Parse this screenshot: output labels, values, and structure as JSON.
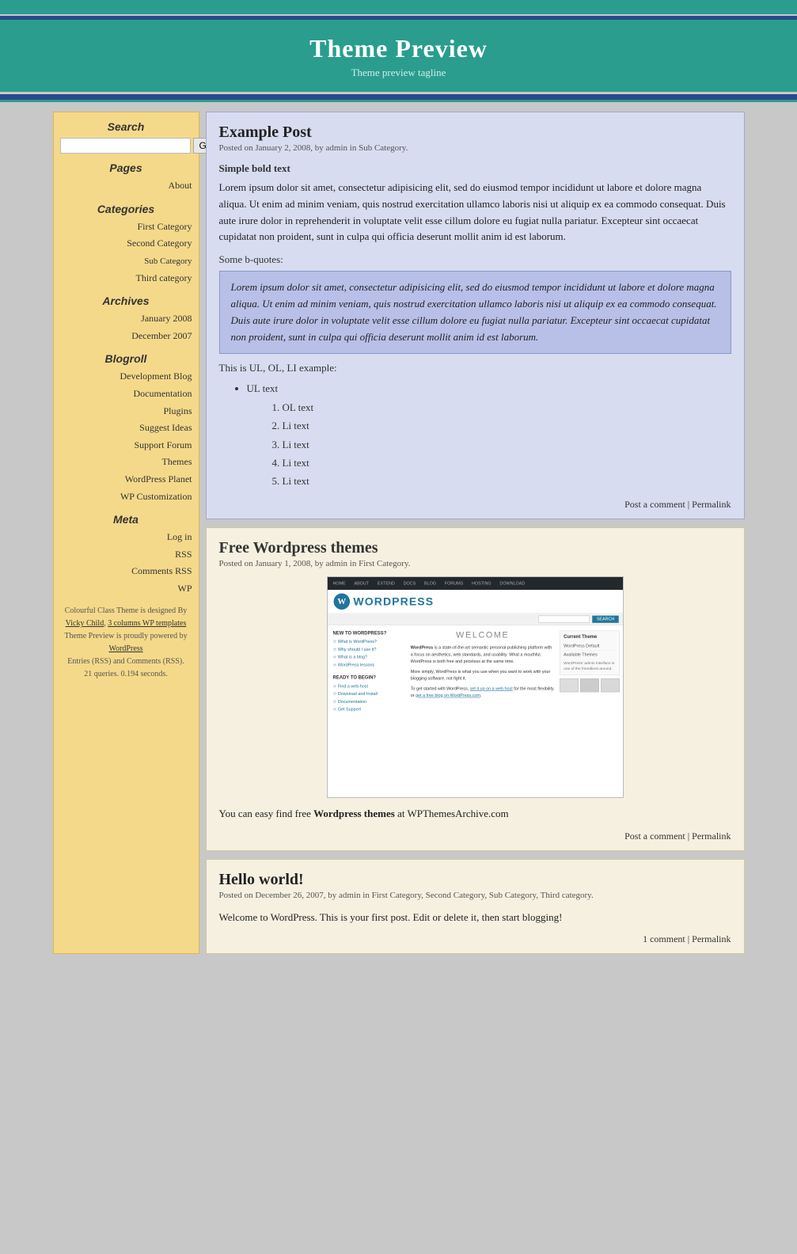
{
  "header": {
    "top_bar_color": "#2a9d8f",
    "bottom_bar_color": "#2a4a8a",
    "title": "Theme Preview",
    "tagline": "Theme preview tagline"
  },
  "sidebar": {
    "search_label": "Search",
    "search_placeholder": "",
    "search_button": "Go!",
    "pages_label": "Pages",
    "pages": [
      {
        "label": "About"
      }
    ],
    "categories_label": "Categories",
    "categories": [
      {
        "label": "First Category"
      },
      {
        "label": "Second Category"
      },
      {
        "label": "Sub Category",
        "sub": true
      },
      {
        "label": "Third category"
      }
    ],
    "archives_label": "Archives",
    "archives": [
      {
        "label": "January 2008"
      },
      {
        "label": "December 2007"
      }
    ],
    "blogroll_label": "Blogroll",
    "blogroll": [
      {
        "label": "Development Blog"
      },
      {
        "label": "Documentation"
      },
      {
        "label": "Plugins"
      },
      {
        "label": "Suggest Ideas"
      },
      {
        "label": "Support Forum"
      },
      {
        "label": "Themes"
      },
      {
        "label": "WordPress Planet"
      },
      {
        "label": "WP Customization"
      }
    ],
    "meta_label": "Meta",
    "meta": [
      {
        "label": "Log in"
      },
      {
        "label": "RSS"
      },
      {
        "label": "Comments RSS"
      },
      {
        "label": "WP"
      }
    ],
    "footer_text1": "Colourful Class Theme is designed By",
    "footer_link1": "Vicky Child",
    "footer_link2": "3 columns WP templates",
    "footer_text2": "Theme Preview is proudly powered by",
    "footer_link3": "WordPress",
    "footer_text3": "Entries (RSS) and Comments (RSS).",
    "footer_text4": "21 queries. 0.194 seconds."
  },
  "posts": [
    {
      "id": "example-post",
      "title": "Example Post",
      "meta": "Posted on January 2, 2008, by admin in Sub Category.",
      "bold_heading": "Simple bold text",
      "paragraph1": "Lorem ipsum dolor sit amet, consectetur adipisicing elit, sed do eiusmod tempor incididunt ut labore et dolore magna aliqua. Ut enim ad minim veniam, quis nostrud exercitation ullamco laboris nisi ut aliquip ex ea commodo consequat. Duis aute irure dolor in reprehenderit in voluptate velit esse cillum dolore eu fugiat nulla pariatur. Excepteur sint occaecat cupidatat non proident, sunt in culpa qui officia deserunt mollit anim id est laborum.",
      "bquotes_label": "Some b-quotes:",
      "blockquote": "Lorem ipsum dolor sit amet, consectetur adipisicing elit, sed do eiusmod tempor incididunt ut labore et dolore magna aliqua. Ut enim ad minim veniam, quis nostrud exercitation ullamco laboris nisi ut aliquip ex ea commodo consequat. Duis aute irure dolor in voluptate velit esse cillum dolore eu fugiat nulla pariatur. Excepteur sint occaecat cupidatat non proident, sunt in culpa qui officia deserunt mollit anim id est laborum.",
      "ul_intro": "This is UL, OL, LI example:",
      "ul_item": "UL text",
      "ol_item": "OL text",
      "li_items": [
        "Li text",
        "Li text",
        "Li text",
        "Li text"
      ],
      "footer": "Post a comment | Permalink"
    },
    {
      "id": "free-wp-themes",
      "title": "Free Wordpress themes",
      "meta": "Posted on January 1, 2008, by admin in First Category.",
      "content": "You can easy find free Wordpress themes at WPThemesArchive.com",
      "footer": "Post a comment | Permalink"
    },
    {
      "id": "hello-world",
      "title": "Hello world!",
      "meta": "Posted on December 26, 2007, by admin in First Category, Second Category, Sub Category, Third category.",
      "content": "Welcome to WordPress. This is your first post. Edit or delete it, then start blogging!",
      "footer": "1 comment | Permalink"
    }
  ],
  "wp_mock": {
    "nav_items": [
      "HOME",
      "ABOUT",
      "EXTEND",
      "DOCS",
      "BLOG",
      "FORUMS",
      "HOSTING",
      "DOWNLOAD"
    ],
    "welcome": "WELCOME",
    "intro_bold": "WordPress",
    "intro_text": " is a state-of-the-art semantic personal publishing platform with a focus on aesthetics, web standards, and usability. What a mouthful. WordPress is both free and priceless at the same time.",
    "more_text": "More simply, WordPress is what you use when you want to work with your blogging software, not fight it.",
    "get_started": "To get started with WordPress, ",
    "get_started_link1": "set it up on a web host",
    "get_started_text": " for the most flexibility or ",
    "get_started_link2": "get a free blog on WordPress.com",
    "sidebar_title": "Current Theme",
    "sidebar_items": [
      "WordPress' admin interface is one of the friendliest around."
    ],
    "ready_title": "READY TO BEGIN?",
    "ready_items": [
      "Find a web host",
      "Download and Install",
      "Documentation",
      "Get Support"
    ],
    "new_to_wp": "NEW TO WORDPRESS?",
    "new_items": [
      "What is WordPress?",
      "Why should I use it?",
      "What is a blog?",
      "WordPress lessons"
    ]
  }
}
